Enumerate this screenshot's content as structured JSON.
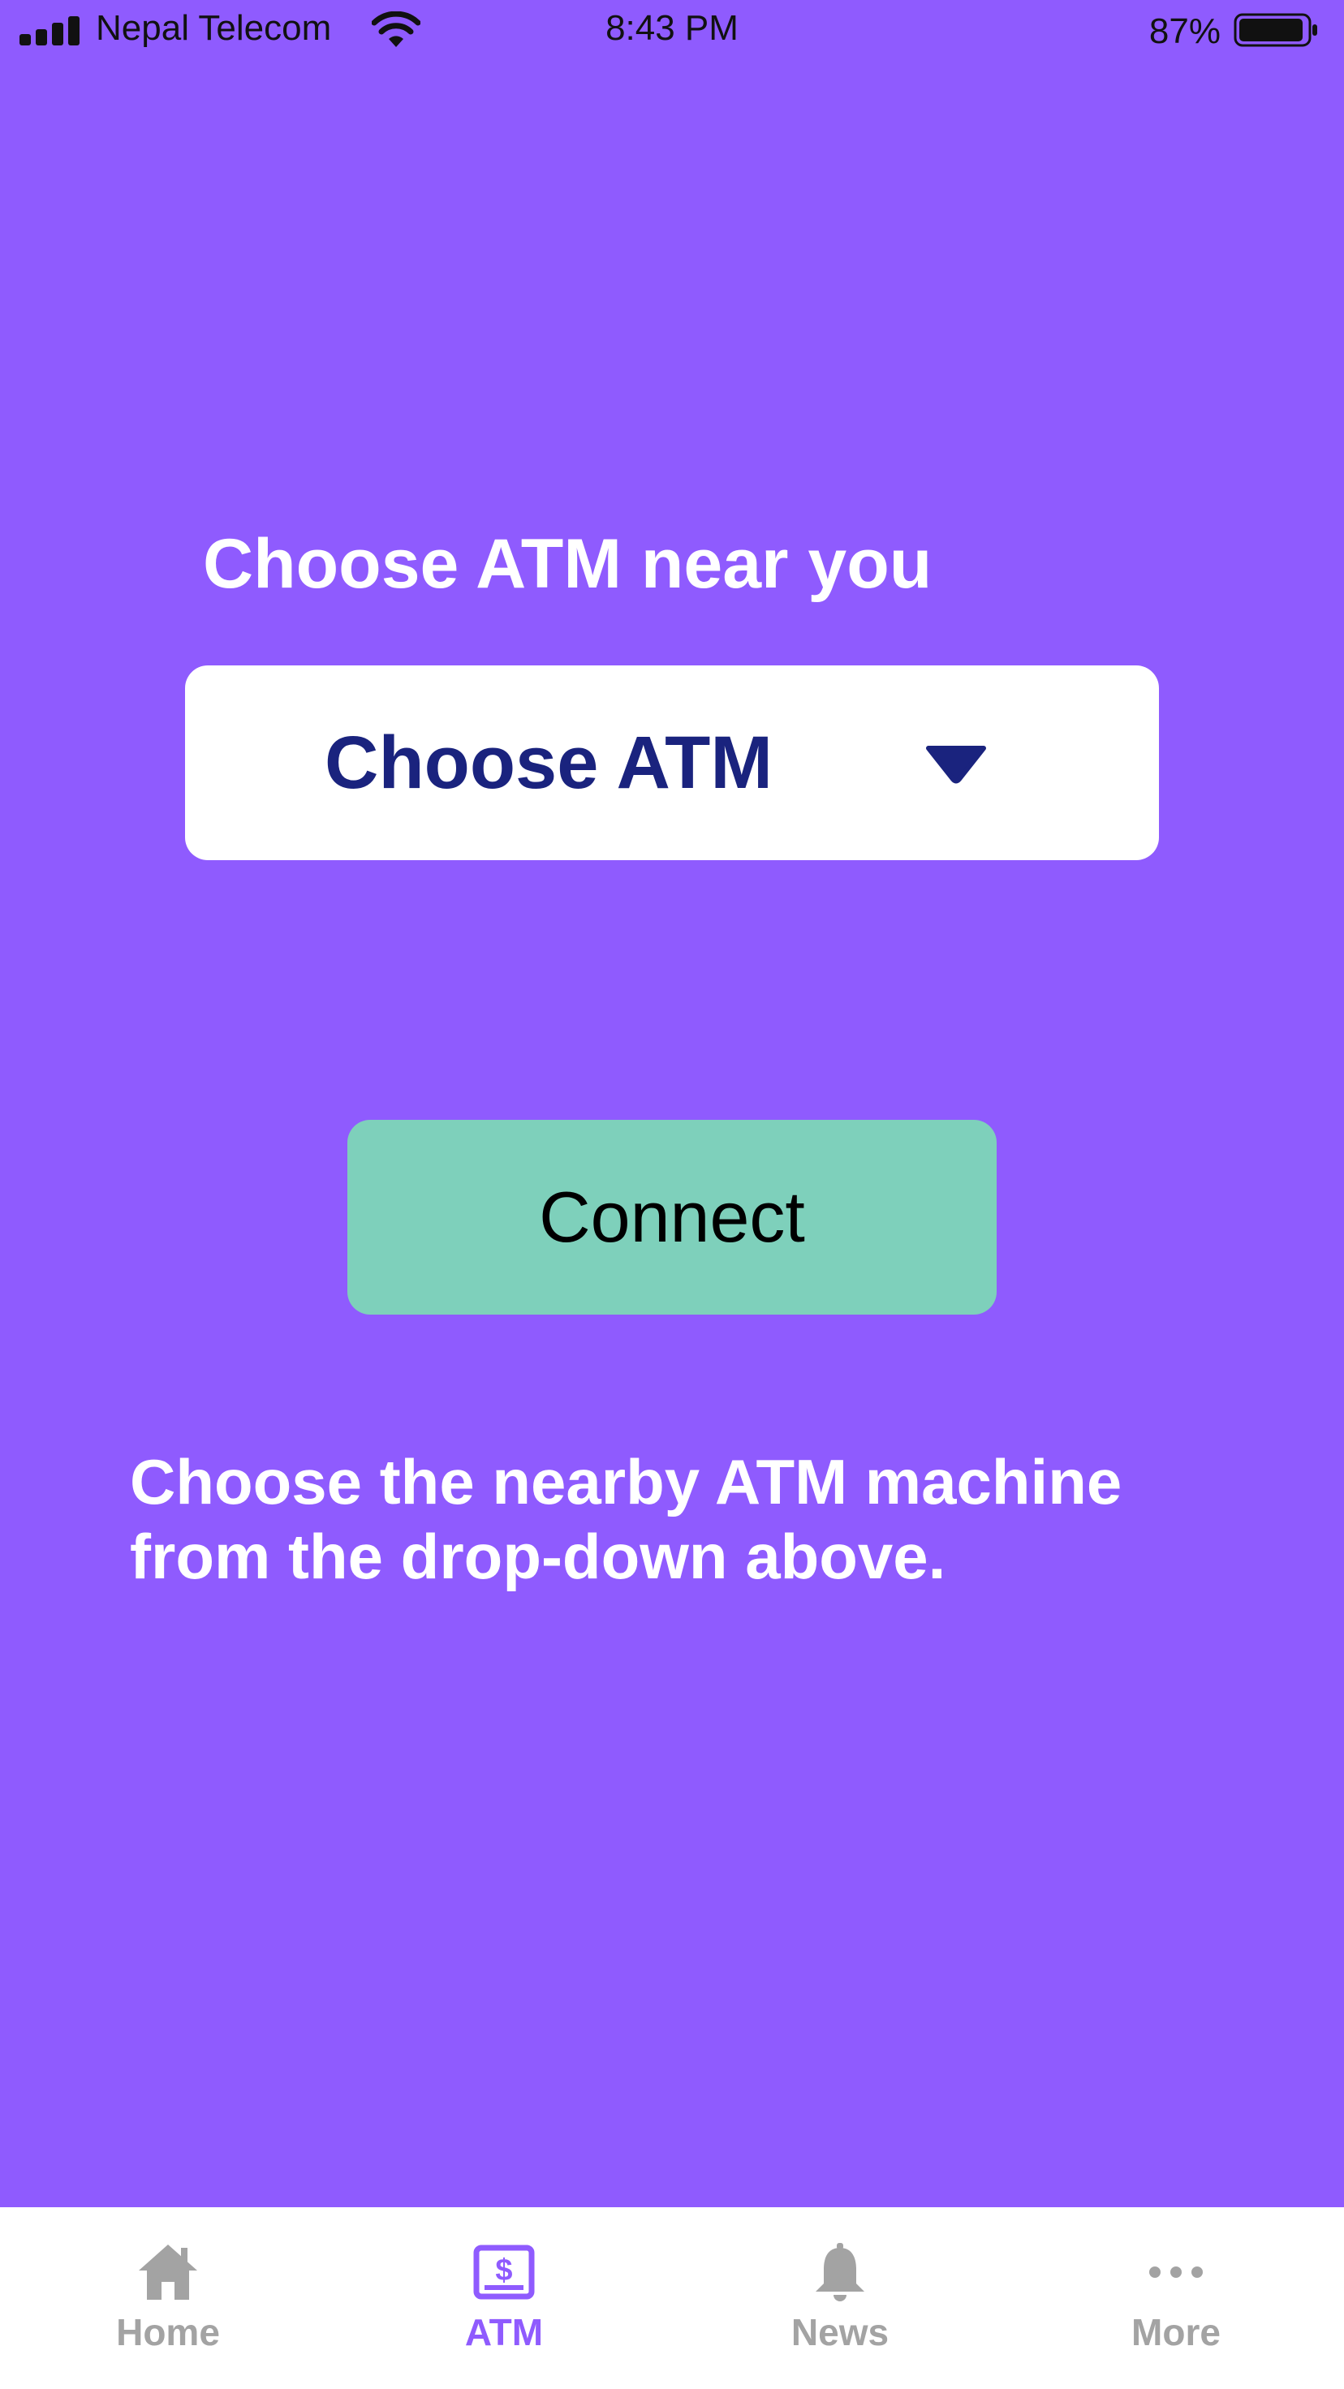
{
  "status_bar": {
    "carrier": "Nepal Telecom",
    "time": "8:43 PM",
    "battery_percent": "87%"
  },
  "main": {
    "heading": "Choose ATM near you",
    "dropdown": {
      "selected": "Choose ATM"
    },
    "connect_button": "Connect",
    "help_text": "Choose the nearby ATM machine from the drop-down above."
  },
  "tab_bar": {
    "active": "ATM",
    "tabs": [
      {
        "label": "Home",
        "icon": "home-icon"
      },
      {
        "label": "ATM",
        "icon": "atm-dollar-icon"
      },
      {
        "label": "News",
        "icon": "bell-icon"
      },
      {
        "label": "More",
        "icon": "ellipsis-icon"
      }
    ]
  },
  "colors": {
    "background": "#8f5bfe",
    "dropdown_text": "#1a237e",
    "connect_button": "#7ed0bb",
    "tab_active": "#8f5bfe",
    "tab_inactive": "#a3a3a3"
  }
}
